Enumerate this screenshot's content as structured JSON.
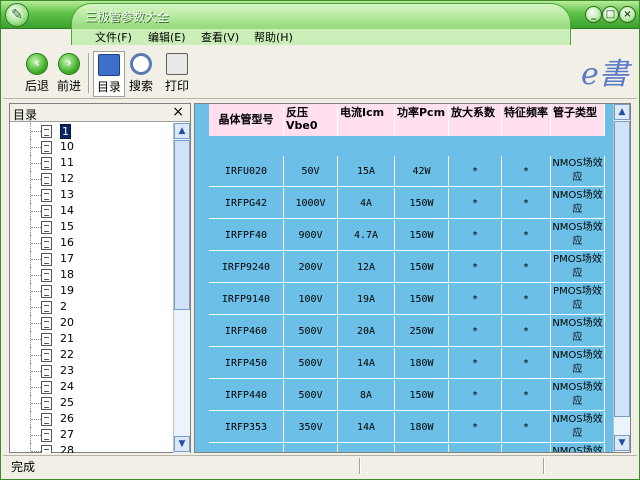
{
  "window": {
    "title": "三极管参数大全"
  },
  "menu": [
    "文件(F)",
    "编辑(E)",
    "查看(V)",
    "帮助(H)"
  ],
  "toolbar": {
    "back": "后退",
    "forward": "前进",
    "contents": "目录",
    "search": "搜索",
    "print": "打印",
    "logo": "e書"
  },
  "sidebar": {
    "title": "目录",
    "close": "×",
    "items": [
      "1",
      "10",
      "11",
      "12",
      "13",
      "14",
      "15",
      "16",
      "17",
      "18",
      "19",
      "2",
      "20",
      "21",
      "22",
      "23",
      "24",
      "25",
      "26",
      "27",
      "28"
    ],
    "selected_index": 0
  },
  "table": {
    "headers": [
      "晶体管型号",
      "反压Vbe0",
      "电流Icm",
      "功率Pcm",
      "放大系数",
      "特征频率",
      "管子类型"
    ],
    "rows": [
      [
        "IRFU020",
        "50V",
        "15A",
        "42W",
        "*",
        "*",
        "NMOS场效应"
      ],
      [
        "IRFPG42",
        "1000V",
        "4A",
        "150W",
        "*",
        "*",
        "NMOS场效应"
      ],
      [
        "IRFPF40",
        "900V",
        "4.7A",
        "150W",
        "*",
        "*",
        "NMOS场效应"
      ],
      [
        "IRFP9240",
        "200V",
        "12A",
        "150W",
        "*",
        "*",
        "PMOS场效应"
      ],
      [
        "IRFP9140",
        "100V",
        "19A",
        "150W",
        "*",
        "*",
        "PMOS场效应"
      ],
      [
        "IRFP460",
        "500V",
        "20A",
        "250W",
        "*",
        "*",
        "NMOS场效应"
      ],
      [
        "IRFP450",
        "500V",
        "14A",
        "180W",
        "*",
        "*",
        "NMOS场效应"
      ],
      [
        "IRFP440",
        "500V",
        "8A",
        "150W",
        "*",
        "*",
        "NMOS场效应"
      ],
      [
        "IRFP353",
        "350V",
        "14A",
        "180W",
        "*",
        "*",
        "NMOS场效应"
      ],
      [
        "",
        "",
        "",
        "",
        "",
        "",
        "NMOS场效"
      ]
    ]
  },
  "status": {
    "text": "完成"
  },
  "colors": {
    "title_green": "#3aa02e",
    "grid_blue": "#6cc0e8",
    "header_pink": "#ffdff0"
  }
}
